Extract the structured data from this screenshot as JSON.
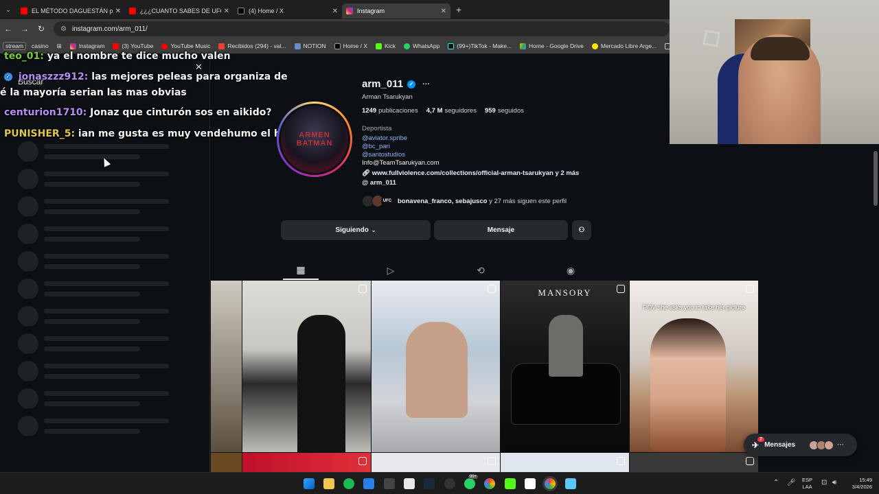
{
  "browser": {
    "tabs": [
      {
        "title": "EL MÉTODO DAGUESTÁN para",
        "favicon_color": "#ff0000"
      },
      {
        "title": "¿¿¿CUANTO SABES DE UFC???",
        "favicon_color": "#ff0000"
      },
      {
        "title": "(4) Home / X",
        "favicon_color": "#000000"
      },
      {
        "title": "Instagram",
        "favicon_color": "#d6249f"
      }
    ],
    "active_tab_index": 3,
    "url": "instagram.com/arm_011/",
    "bookmarks": [
      {
        "label": "stream",
        "icon": "pill"
      },
      {
        "label": "casino",
        "icon": "none"
      },
      {
        "label": "",
        "icon": "apps-grid-icon"
      },
      {
        "label": "Instagram",
        "icon": "instagram-icon"
      },
      {
        "label": "(3) YouTube",
        "icon": "youtube-icon"
      },
      {
        "label": "YouTube Music",
        "icon": "youtube-music-icon"
      },
      {
        "label": "Recibidos (294) - val...",
        "icon": "gmail-icon"
      },
      {
        "label": "NOTION",
        "icon": "notion-icon"
      },
      {
        "label": "Home / X",
        "icon": "x-icon"
      },
      {
        "label": "Kick",
        "icon": "kick-icon"
      },
      {
        "label": "WhatsApp",
        "icon": "whatsapp-icon"
      },
      {
        "label": "(99+)TikTok - Make...",
        "icon": "tiktok-icon"
      },
      {
        "label": "Home - Google Drive",
        "icon": "drive-icon"
      },
      {
        "label": "Mercado Libre Arge...",
        "icon": "mercadolibre-icon"
      },
      {
        "label": "PR",
        "icon": "folder-icon"
      }
    ]
  },
  "sidebar": {
    "search_label": "Buscar",
    "skeleton_rows": 11
  },
  "chat": [
    {
      "user": "teo_01:",
      "message": "ya el nombre te dice mucho valen",
      "color": "green"
    },
    {
      "user": "jonaszzz912:",
      "message": "las mejores peleas para organiza de",
      "color": "purple",
      "verified": true
    },
    {
      "user": "",
      "message": "é la mayoría serian las mas obvias",
      "color": "none"
    },
    {
      "user": "centurion1710:",
      "message": "Jonaz que cinturón sos en aikido?",
      "color": "purple"
    },
    {
      "user": "PUNISHER_5:",
      "message": "ian me gusta es muy vendehumo el ho",
      "color": "yellow"
    }
  ],
  "profile": {
    "username": "arm_011",
    "full_name": "Arman Tsarukyan",
    "posts_count": "1249",
    "posts_label": "publicaciones",
    "followers_count": "4,7 M",
    "followers_label": "seguidores",
    "following_count": "959",
    "following_label": "seguidos",
    "category": "Deportista",
    "bio_links": [
      "@aviator.spribe",
      "@bc_pari",
      "@santostudios"
    ],
    "bio_email": "Info@TeamTsarukyan.com",
    "external_link": "www.fullviolence.com/collections/official-arman-tsarukyan y 2 más",
    "threads_handle": "arm_011",
    "followed_by_names": "bonavena_franco, sebajusco",
    "followed_by_suffix": "y 27 más siguen este perfil",
    "follow_button": "Siguiendo",
    "message_button": "Mensaje",
    "avatar_text": "ARMEN BATMAN"
  },
  "profile_tabs": [
    "posts-grid",
    "reels",
    "reposts",
    "tagged"
  ],
  "grid_captions": {
    "mansory": "MANSORY",
    "pov": "POV she asks you to take her picture"
  },
  "messages_widget": {
    "label": "Mensajes",
    "badge": "7"
  },
  "taskbar": {
    "lang_line1": "ESP",
    "lang_line2": "LAA",
    "time": "15:49",
    "date": "3/4/2026",
    "whatsapp_badge": "99+"
  }
}
